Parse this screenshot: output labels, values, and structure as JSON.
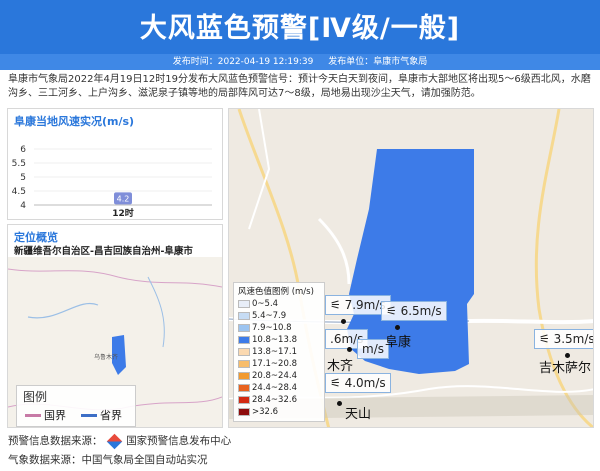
{
  "header": {
    "title": "大风蓝色预警[Ⅳ级/一般]"
  },
  "meta": {
    "time": "发布时间：2022-04-19 12:19:39",
    "unit": "发布单位：阜康市气象局"
  },
  "description": "阜康市气象局2022年4月19日12时19分发布大风蓝色预警信号：预计今天白天到夜间，阜康市大部地区将出现5～6级西北风，水磨沟乡、三工河乡、上户沟乡、滋泥泉子镇等地的局部阵风可达7～8级，局地易出现沙尘天气，请加强防范。",
  "wind_panel": {
    "title": "阜康当地风速实况(m/s)"
  },
  "chart_data": {
    "type": "scatter",
    "title": "阜康当地风速实况(m/s)",
    "categories": [
      "12时"
    ],
    "values": [
      4.2
    ],
    "data_labels": [
      "4.2"
    ],
    "yticks": [
      "6",
      "5.5",
      "5",
      "4.5",
      "4"
    ],
    "ylim": [
      4,
      6
    ],
    "xlabel": "",
    "ylabel": ""
  },
  "loc_panel": {
    "title": "定位概览",
    "subtitle": "新疆维吾尔自治区-昌吉回族自治州-阜康市",
    "map_label": "乌鲁木齐",
    "legend_title": "图例",
    "legend_items": [
      "国界",
      "省界"
    ]
  },
  "map_legend": {
    "title": "风速色值图例 (m/s)",
    "items": [
      {
        "label": "0~5.4",
        "color": "#e8eef8"
      },
      {
        "label": "5.4~7.9",
        "color": "#c6dcf4"
      },
      {
        "label": "7.9~10.8",
        "color": "#9cc4f0"
      },
      {
        "label": "10.8~13.8",
        "color": "#3d7be8"
      },
      {
        "label": "13.8~17.1",
        "color": "#fbd9b0"
      },
      {
        "label": "17.1~20.8",
        "color": "#f8bd6a"
      },
      {
        "label": "20.8~24.4",
        "color": "#f29a2f"
      },
      {
        "label": "24.4~28.4",
        "color": "#e8621e"
      },
      {
        "label": "28.4~32.6",
        "color": "#d22a12"
      },
      {
        "label": ">32.6",
        "color": "#8e0c0c"
      }
    ]
  },
  "map_labels": {
    "wind1": "7.9m/s",
    "wind2": "6.5m/s",
    "wind3": ".6m/s",
    "wind4": "m/s",
    "wind5": "4.0m/s",
    "wind6": "3.5m/s",
    "place1": "阜康",
    "place2": "吉木萨尔",
    "place3": "天山",
    "place4": "木齐"
  },
  "sources": {
    "warn": "预警信息数据来源：",
    "warn_src": "国家预警信息发布中心",
    "weather": "气象数据来源：中国气象局全国自动站实况"
  },
  "colors": {
    "accent": "#2a77db",
    "warning_area": "#3d7be8"
  }
}
